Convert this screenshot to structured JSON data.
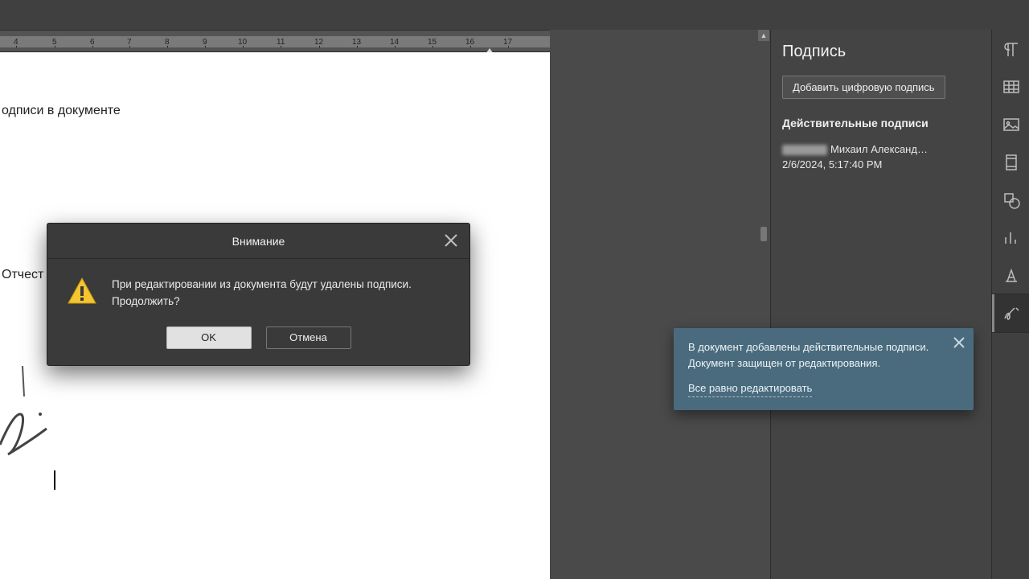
{
  "ruler": {
    "ticks": [
      4,
      5,
      6,
      7,
      8,
      9,
      10,
      11,
      12,
      13,
      14,
      15,
      16,
      17
    ]
  },
  "document": {
    "line1": "одписи в документе",
    "line2": "Отчест",
    "cursor_visible": true
  },
  "side_panel": {
    "title": "Подпись",
    "add_button": "Добавить цифровую подпись",
    "valid_header": "Действительные подписи",
    "signature": {
      "name": "Михаил Александ…",
      "timestamp": "2/6/2024, 5:17:40 PM"
    }
  },
  "rail_items": [
    {
      "name": "paragraph-icon",
      "active": false
    },
    {
      "name": "table-icon",
      "active": false
    },
    {
      "name": "image-icon",
      "active": false
    },
    {
      "name": "page-icon",
      "active": false
    },
    {
      "name": "shape-icon",
      "active": false
    },
    {
      "name": "chart-icon",
      "active": false
    },
    {
      "name": "textart-icon",
      "active": false
    },
    {
      "name": "signature-icon",
      "active": true
    }
  ],
  "toast": {
    "line1": "В документ добавлены действительные подписи.",
    "line2": "Документ защищен от редактирования.",
    "link": "Все равно редактировать"
  },
  "modal": {
    "title": "Внимание",
    "message_l1": "При редактировании из документа будут удалены подписи.",
    "message_l2": "Продолжить?",
    "ok": "OK",
    "cancel": "Отмена"
  }
}
